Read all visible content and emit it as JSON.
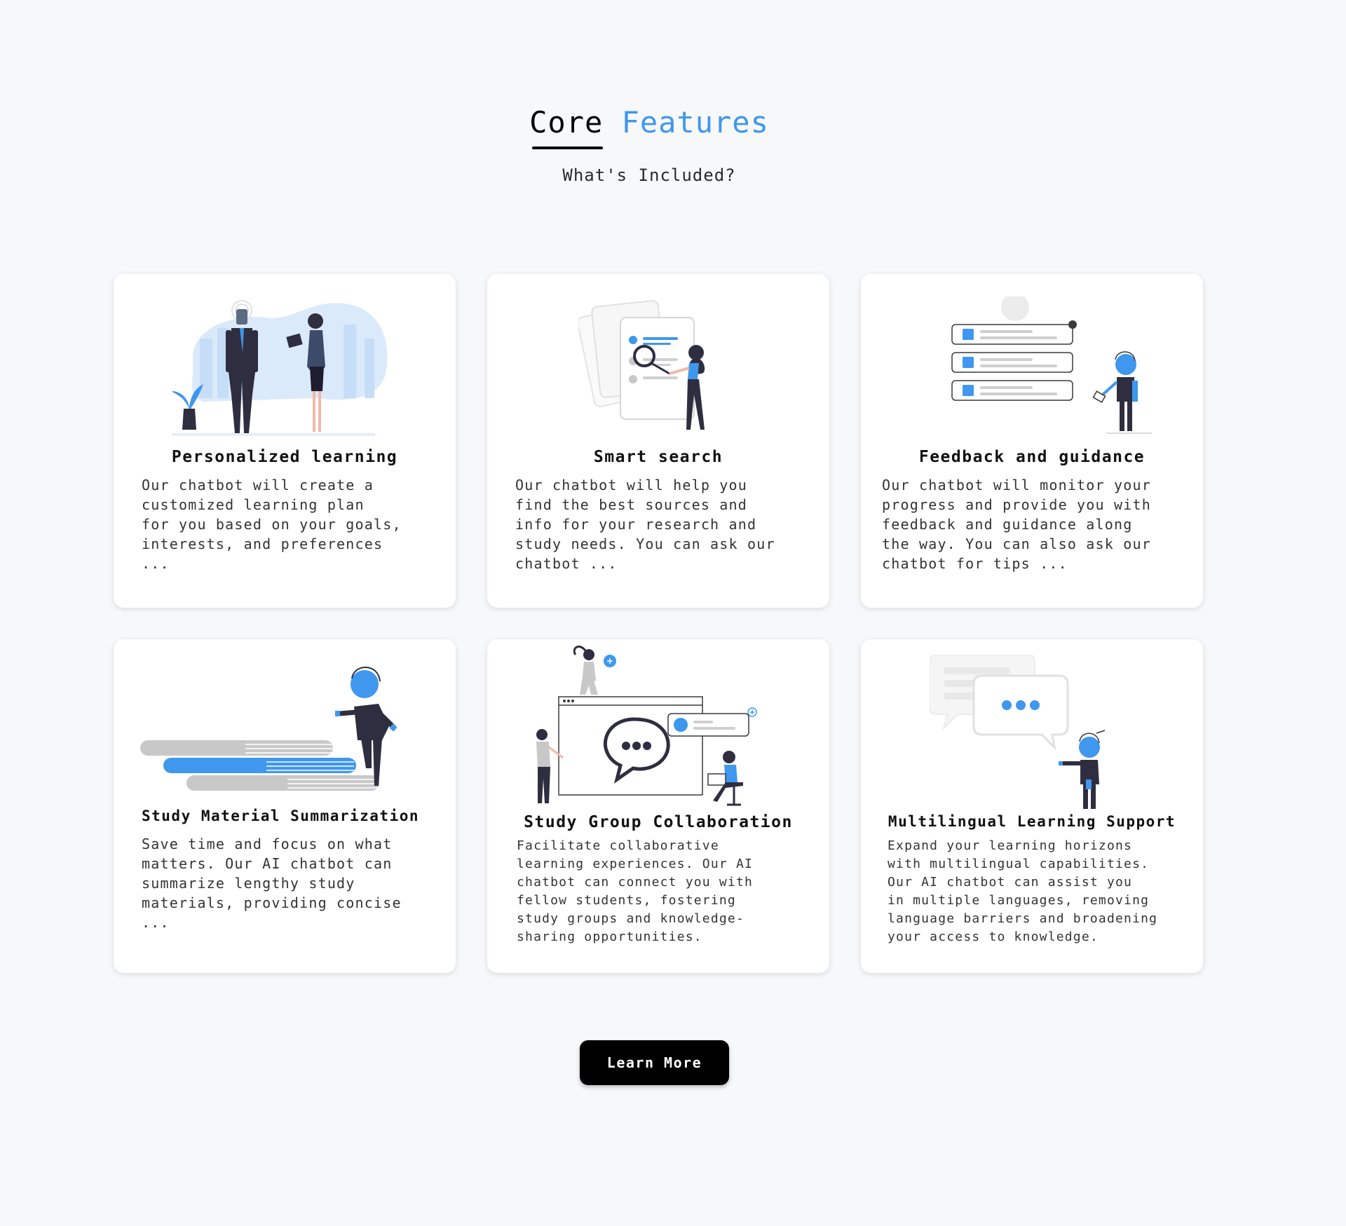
{
  "header": {
    "title_part1": "Core",
    "title_part2": "Features",
    "subtitle": "What's Included?"
  },
  "colors": {
    "accent": "#3f97ee",
    "dark": "#2f2e41",
    "background": "#f7f8fa",
    "button": "#000000"
  },
  "cards": [
    {
      "title": "Personalized learning",
      "description": "Our chatbot will create a\ncustomized learning plan\nfor you based on your goals,\ninterests, and preferences\n...",
      "illustration": "business-people-illustration"
    },
    {
      "title": "Smart search",
      "description": "Our chatbot will help you\nfind the best sources and\ninfo for your research and\nstudy needs. You can ask our\nchatbot ...",
      "illustration": "search-documents-illustration"
    },
    {
      "title": "Feedback and guidance",
      "description": "Our chatbot will monitor your\nprogress and provide you with\nfeedback and guidance along\nthe way. You can also ask our\nchatbot for tips ...",
      "illustration": "checklist-illustration"
    },
    {
      "title": "Study Material Summarization",
      "description": "Save time and focus on what\nmatters. Our AI chatbot can\nsummarize lengthy study\nmaterials, providing concise\n...",
      "illustration": "books-stack-illustration"
    },
    {
      "title": "Study Group Collaboration",
      "description": "Facilitate collaborative\nlearning experiences. Our AI\nchatbot can connect you with\nfellow students, fostering\nstudy groups and knowledge-\nsharing opportunities.",
      "illustration": "group-chat-illustration"
    },
    {
      "title": "Multilingual Learning Support",
      "description": "Expand your learning horizons\nwith multilingual capabilities.\nOur AI chatbot can assist you\nin multiple languages, removing\nlanguage barriers and broadening\nyour access to knowledge.",
      "illustration": "chat-bubbles-illustration"
    }
  ],
  "cta": {
    "label": "Learn More"
  }
}
